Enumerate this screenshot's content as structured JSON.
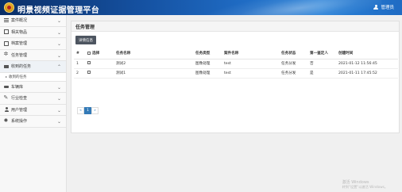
{
  "header": {
    "title": "明景视频证据管理平台",
    "user_label": "管理员"
  },
  "sidebar": {
    "items": [
      {
        "label": "案件概况",
        "icon": "bars-icon"
      },
      {
        "label": "相关物品",
        "icon": "box-icon"
      },
      {
        "label": "档案管理",
        "icon": "file-icon"
      },
      {
        "label": "任务管理",
        "icon": "gear-icon"
      },
      {
        "label": "收到的任务",
        "icon": "folder-icon"
      },
      {
        "label": "车辆库",
        "icon": "car-icon"
      },
      {
        "label": "行业检查",
        "icon": "wrench-icon"
      },
      {
        "label": "用户管理",
        "icon": "user-icon"
      },
      {
        "label": "系统操作",
        "icon": "cog-icon"
      }
    ],
    "sub_item": "收到的任务"
  },
  "main": {
    "panel_title": "任务管理",
    "detail_button": "详情信息",
    "table": {
      "columns": [
        "#",
        "选择",
        "任务名称",
        "任务类型",
        "案件名称",
        "任务状态",
        "第一鉴定人",
        "创建时间"
      ],
      "rows": [
        {
          "no": "1",
          "name": "测试2",
          "type": "图像处理",
          "case": "test",
          "status": "任务分发",
          "appraiser": "否",
          "time": "2021-01-12 11:56:45"
        },
        {
          "no": "2",
          "name": "测试1",
          "type": "图像处理",
          "case": "test",
          "status": "任务分发",
          "appraiser": "是",
          "time": "2021-01-11 17:45:52"
        }
      ]
    },
    "pager": {
      "prev": "«",
      "current": "1",
      "next": "»"
    }
  },
  "watermark": {
    "line1": "激活 Windows",
    "line2": "转到\"设置\"以激活 Windows。"
  }
}
